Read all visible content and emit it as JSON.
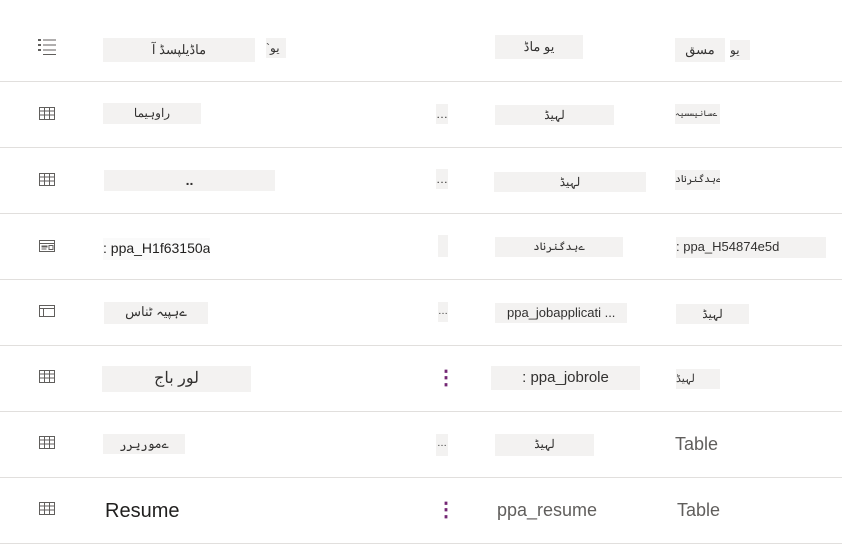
{
  "header": {
    "icon": "list-icon",
    "name": "ماڈیلپسڈ آ",
    "name_tail": "`یو",
    "schema": "یو ماڈ",
    "type": "مسق",
    "type_tail": "یو"
  },
  "rows": [
    {
      "icon": "table-icon",
      "name": "راوہیما",
      "more": "…",
      "schema": "لہیڈ",
      "type": "رایتہ ےسانیسسیہ"
    },
    {
      "icon": "table-icon",
      "name": "..",
      "more": "…",
      "schema": "لہیڈ",
      "type": "ےہدگنرناد"
    },
    {
      "icon": "form-icon",
      "name": ": ppa_H1f63150a",
      "more": "",
      "schema": "ےہدگنرناد",
      "type": ": ppa_H54874e5d"
    },
    {
      "icon": "view-icon",
      "name": "ےہپیہ ٹناس",
      "more": "…",
      "schema": "ppa_jobapplicati ...",
      "type": "لہیڈ"
    },
    {
      "icon": "table-icon",
      "name": "لور باج",
      "more": "⋮",
      "schema": ": ppa_jobrole",
      "type": "لہیڈ"
    },
    {
      "icon": "table-icon",
      "name": "ےموریرر",
      "more": "…",
      "schema": "لہیڈ",
      "type": "Table"
    },
    {
      "icon": "table-icon",
      "name": "Resume",
      "more": "⋮",
      "schema": "ppa_resume",
      "type": "Table"
    }
  ],
  "colors": {
    "accent": "#742774",
    "divider": "#e1dfdd",
    "highlight": "#f3f2f1"
  }
}
